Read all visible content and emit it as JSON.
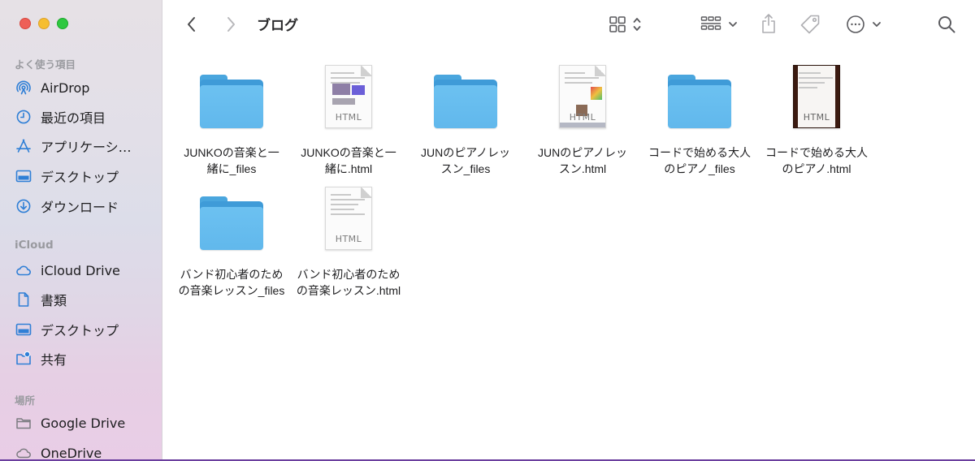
{
  "window": {
    "title": "ブログ"
  },
  "sidebar": {
    "sections": [
      {
        "title": "よく使う項目",
        "items": [
          {
            "label": "AirDrop",
            "icon": "airdrop-icon"
          },
          {
            "label": "最近の項目",
            "icon": "clock-icon"
          },
          {
            "label": "アプリケーシ…",
            "icon": "applications-icon"
          },
          {
            "label": "デスクトップ",
            "icon": "desktop-icon"
          },
          {
            "label": "ダウンロード",
            "icon": "download-icon"
          }
        ]
      },
      {
        "title": "iCloud",
        "items": [
          {
            "label": "iCloud Drive",
            "icon": "cloud-icon"
          },
          {
            "label": "書類",
            "icon": "document-icon"
          },
          {
            "label": "デスクトップ",
            "icon": "desktop-icon"
          },
          {
            "label": "共有",
            "icon": "shared-folder-icon"
          }
        ]
      },
      {
        "title": "場所",
        "items": [
          {
            "label": "Google Drive",
            "icon": "drive-folder-icon"
          },
          {
            "label": "OneDrive",
            "icon": "cloud-icon"
          }
        ]
      }
    ]
  },
  "toolbar": {
    "icons": [
      "back-icon",
      "forward-icon",
      "grid-view-icon",
      "group-icon",
      "share-icon",
      "tag-icon",
      "more-icon",
      "search-icon"
    ]
  },
  "files": [
    {
      "line1": "JUNKOの音楽と一",
      "line2": "緒に_files",
      "kind": "folder"
    },
    {
      "line1": "JUNKOの音楽と一",
      "line2": "緒に.html",
      "kind": "html",
      "thumb_label": "HTML"
    },
    {
      "line1": "JUNのピアノレッ",
      "line2": "スン_files",
      "kind": "folder"
    },
    {
      "line1": "JUNのピアノレッ",
      "line2": "スン.html",
      "kind": "html",
      "thumb_label": "HTML"
    },
    {
      "line1": "コードで始める大人",
      "line2": "のピアノ_files",
      "kind": "folder"
    },
    {
      "line1": "コードで始める大人",
      "line2": "のピアノ.html",
      "kind": "html",
      "thumb_label": "HTML"
    },
    {
      "line1": "バンド初心者のため",
      "line2": "の音楽レッスン_files",
      "kind": "folder"
    },
    {
      "line1": "バンド初心者のため",
      "line2": "の音楽レッスン.html",
      "kind": "html",
      "thumb_label": "HTML"
    }
  ],
  "colors": {
    "folder": "#61b8ec",
    "sidebar_icon": "#2f7fd6",
    "close": "#ee5f57",
    "minimize": "#f6be2f",
    "maximize": "#2ec840"
  }
}
